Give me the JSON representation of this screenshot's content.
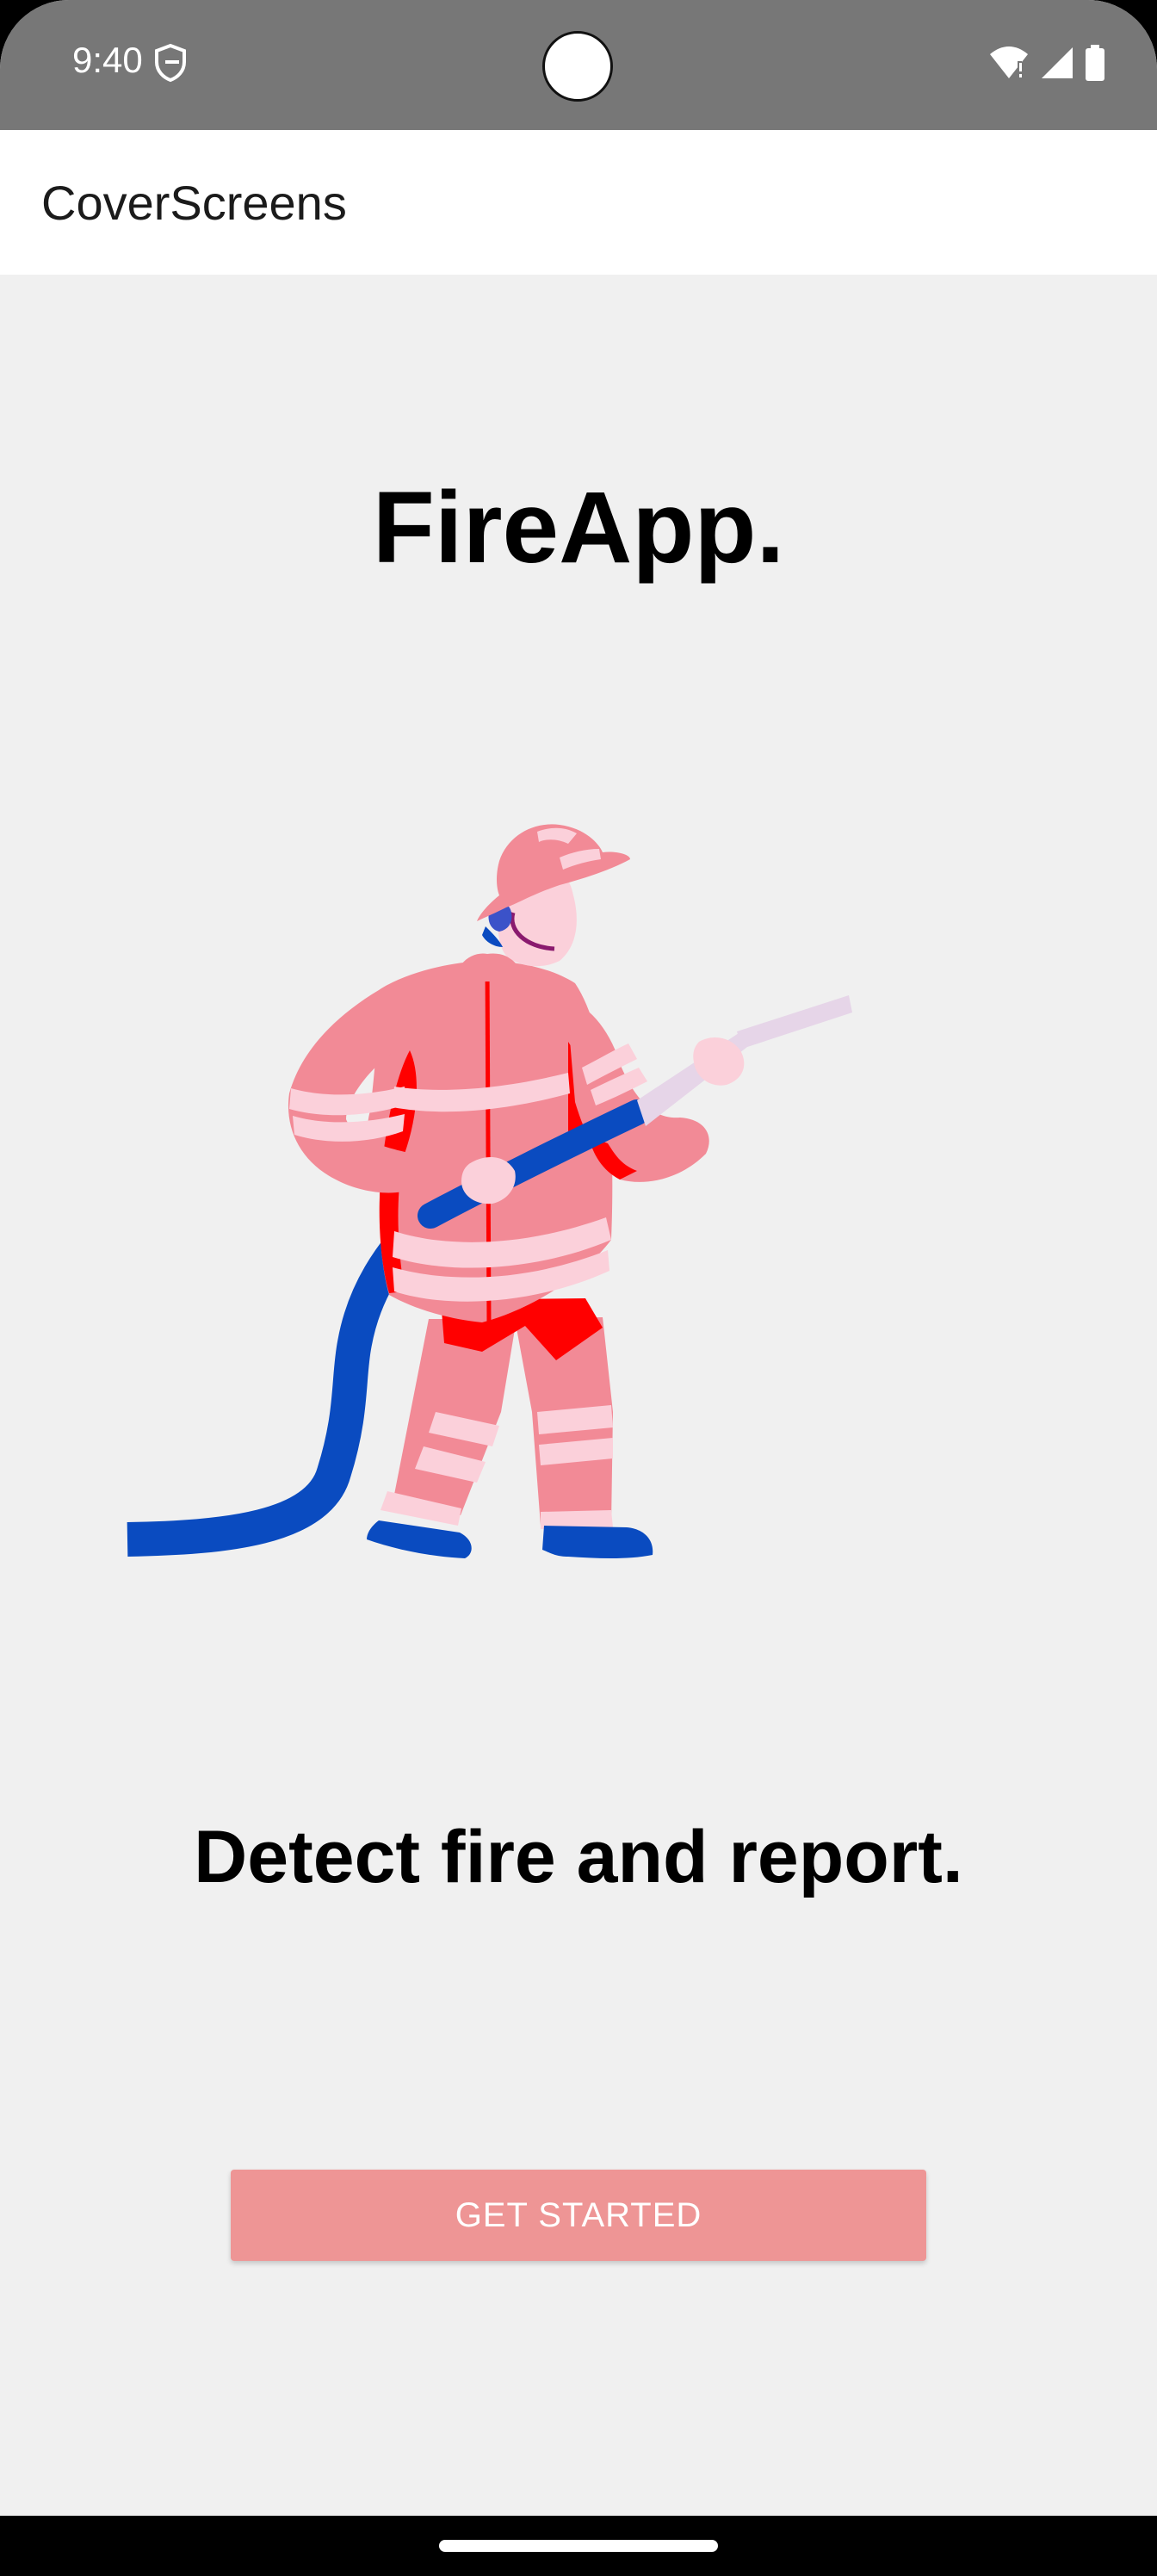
{
  "status_bar": {
    "time": "9:40",
    "icons": [
      "shield-icon",
      "wifi-icon",
      "signal-icon",
      "battery-icon"
    ],
    "background": "#777777"
  },
  "app_bar": {
    "title": "CoverScreens"
  },
  "main": {
    "headline": "FireApp.",
    "illustration": "firefighter-with-hose",
    "tagline": "Detect fire and report.",
    "cta_label": "GET STARTED"
  },
  "colors": {
    "screen_background": "#f0f0f0",
    "button": "#ee9595",
    "suit": "#f28a96",
    "suit_stripes": "#fbd0da",
    "accent_red": "#ff0000",
    "hose_blue": "#0a4bc0"
  }
}
